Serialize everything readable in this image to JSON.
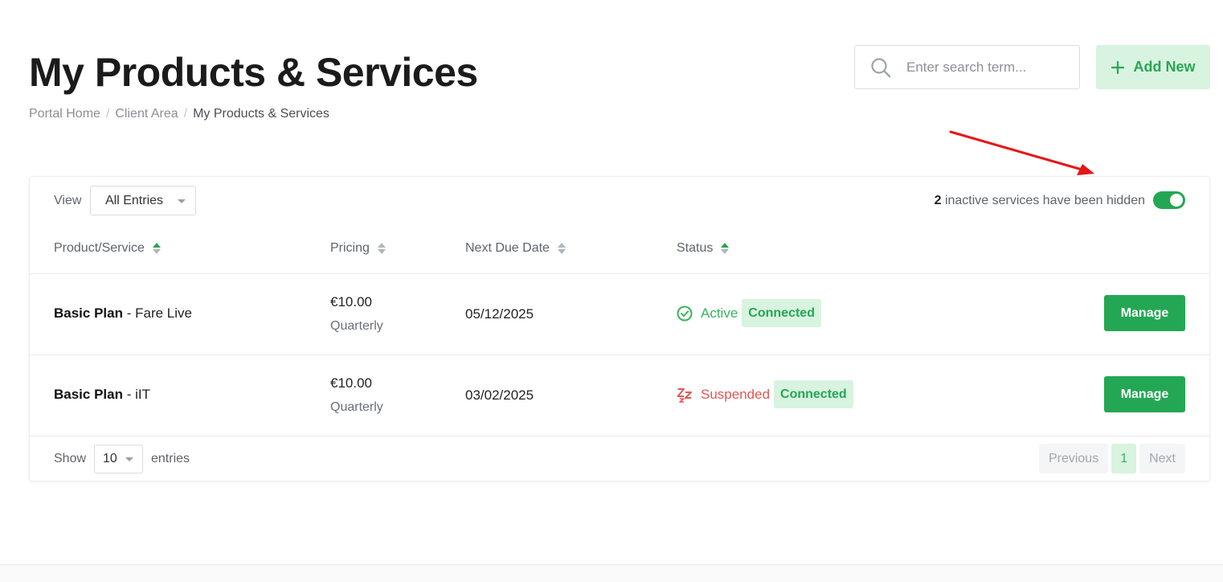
{
  "header": {
    "title": "My Products & Services",
    "breadcrumb": [
      "Portal Home",
      "Client Area",
      "My Products & Services"
    ],
    "search_placeholder": "Enter search term...",
    "add_new_label": "Add New"
  },
  "toolbar": {
    "view_label": "View",
    "view_value": "All Entries",
    "inactive_count": "2",
    "inactive_text": " inactive services have been hidden",
    "toggle_on": true
  },
  "table": {
    "columns": [
      "Product/Service",
      "Pricing",
      "Next Due Date",
      "Status"
    ],
    "rows": [
      {
        "plan": "Basic Plan",
        "name": " - Fare Live",
        "price": "€10.00",
        "cycle": "Quarterly",
        "due": "05/12/2025",
        "status": "Active",
        "badge": "Connected",
        "action": "Manage"
      },
      {
        "plan": "Basic Plan",
        "name": " - iIT",
        "price": "€10.00",
        "cycle": "Quarterly",
        "due": "03/02/2025",
        "status": "Suspended",
        "badge": "Connected",
        "action": "Manage"
      }
    ]
  },
  "footer": {
    "show_label": "Show",
    "show_value": "10",
    "entries_label": "entries",
    "pagination": {
      "previous": "Previous",
      "current": "1",
      "next": "Next"
    }
  },
  "colors": {
    "accent": "#24a754",
    "accent_light": "#d8f3df",
    "suspended": "#e05757",
    "annotation_arrow": "#e51616"
  }
}
